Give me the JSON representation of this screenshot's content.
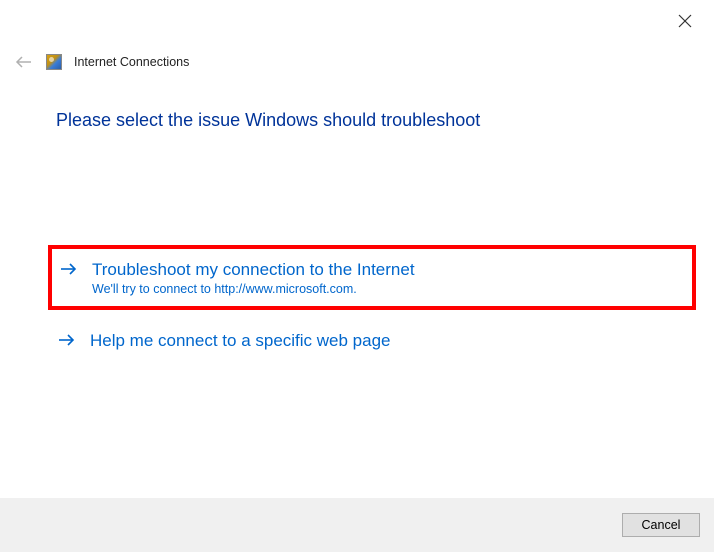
{
  "window": {
    "title": "Internet Connections"
  },
  "main": {
    "heading": "Please select the issue Windows should troubleshoot"
  },
  "options": [
    {
      "title": "Troubleshoot my connection to the Internet",
      "subtitle": "We'll try to connect to http://www.microsoft.com."
    },
    {
      "title": "Help me connect to a specific web page",
      "subtitle": ""
    }
  ],
  "footer": {
    "cancel_label": "Cancel"
  }
}
